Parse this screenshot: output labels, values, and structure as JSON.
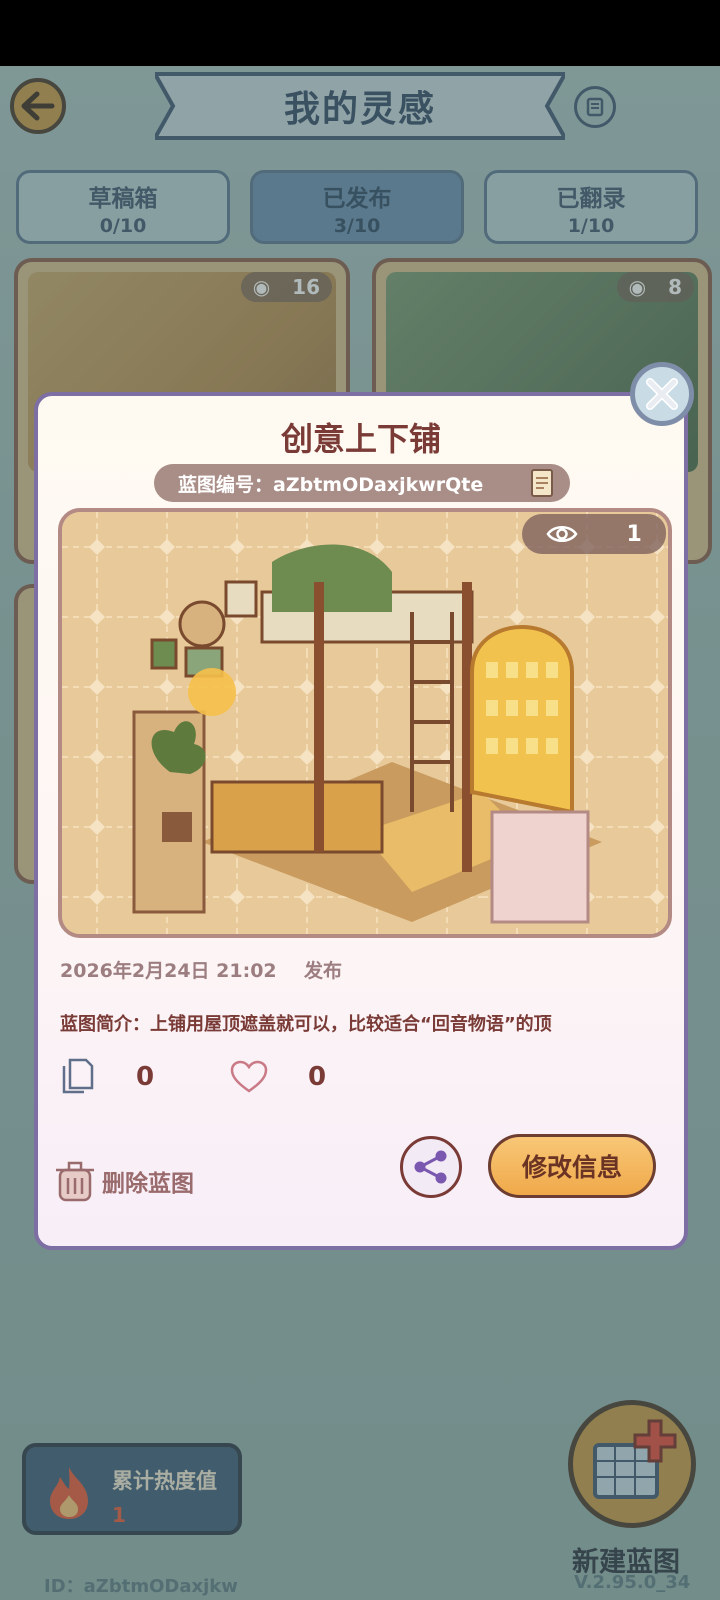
{
  "header": {
    "title": "我的灵感"
  },
  "tabs": [
    {
      "label": "草稿箱",
      "count": "0/10"
    },
    {
      "label": "已发布",
      "count": "3/10"
    },
    {
      "label": "已翻录",
      "count": "1/10"
    }
  ],
  "cards": [
    {
      "views": "16"
    },
    {
      "views": "8"
    }
  ],
  "dialog": {
    "title": "创意上下铺",
    "code": "蓝图编号：aZbtmODaxjkwrQte",
    "views": "1",
    "date": "2026年2月24日 21:02",
    "published_label": "发布",
    "description": "蓝图简介：上铺用屋顶遮盖就可以，比较适合“回音物语”的顶",
    "copy_count": "0",
    "like_count": "0",
    "delete_label": "删除蓝图",
    "edit_label": "修改信息"
  },
  "footer": {
    "heat_label": "累计热度值",
    "heat_value": "1",
    "new_label": "新建蓝图",
    "user_id": "ID：aZbtmODaxjkw",
    "version": "V.2.95.0_34"
  },
  "colors": {
    "accent": "#f0a94a",
    "title_brown": "#7a3b37",
    "header_blue": "#334a66"
  }
}
